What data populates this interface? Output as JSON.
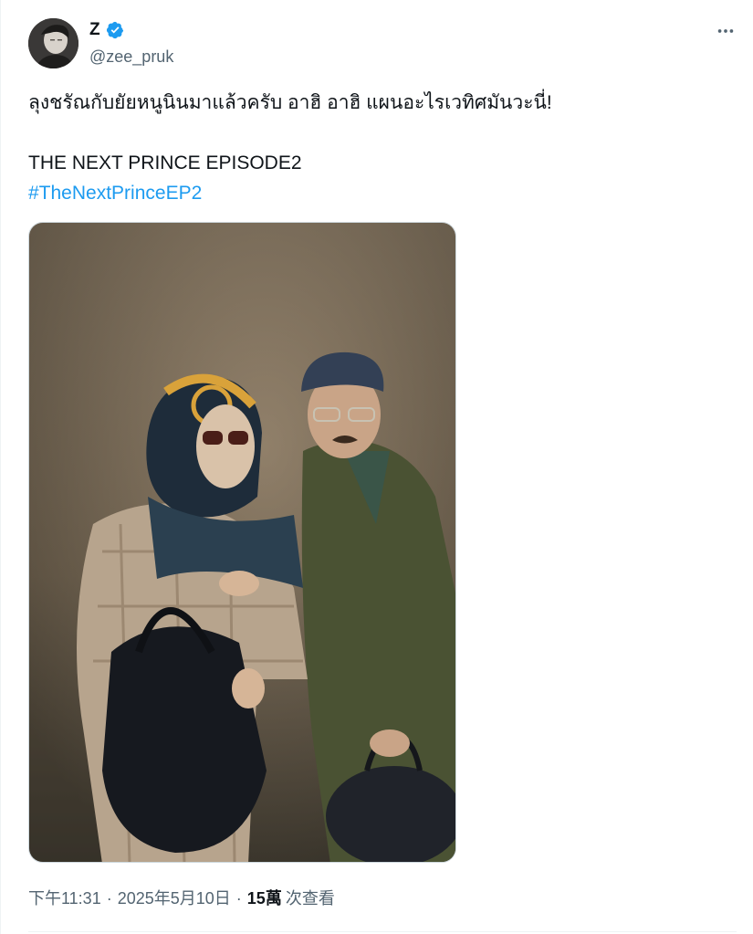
{
  "author": {
    "display_name": "Z",
    "handle": "@zee_pruk",
    "verified": true,
    "verified_icon": "verified-badge-icon",
    "avatar_icon": "profile-avatar"
  },
  "more_icon": "more-horizontal-icon",
  "tweet": {
    "line1": "ลุงชรัณกับยัยหนูนินมาแล้วครับ อาฮิ อาฮิ แผนอะไรเวทิศมันวะนี่!",
    "line2": "THE NEXT PRINCE EPISODE2",
    "hashtag": "#TheNextPrinceEP2"
  },
  "media": {
    "type": "photo"
  },
  "meta": {
    "time": "下午11:31",
    "separator": "·",
    "date": "2025年5月10日",
    "views_count": "15萬",
    "views_label": "次查看"
  },
  "colors": {
    "link": "#1d9bf0",
    "secondary_text": "#536471",
    "primary_text": "#0f1419",
    "verified": "#1d9bf0"
  }
}
